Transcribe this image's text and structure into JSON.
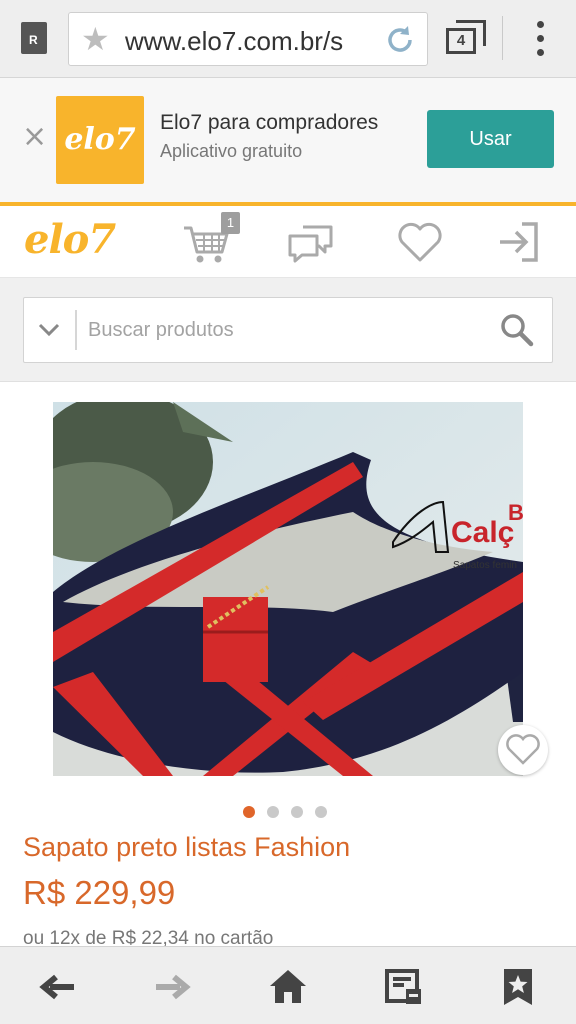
{
  "browser": {
    "url": "www.elo7.com.br/s",
    "tab_count": "4",
    "site_icon_letter": "R"
  },
  "app_banner": {
    "logo_text": "elo7",
    "title": "Elo7 para compradores",
    "subtitle": "Aplicativo gratuito",
    "button_label": "Usar",
    "accent_color": "#2c9f98",
    "logo_color": "#f8b42c"
  },
  "site_nav": {
    "logo": "elo7",
    "cart_count": "1",
    "icons": [
      "cart-icon",
      "chat-icon",
      "heart-icon",
      "login-icon"
    ]
  },
  "search": {
    "placeholder": "Buscar produtos"
  },
  "product": {
    "image_watermark": "Calç",
    "image_watermark_top": "B",
    "image_watermark_sub": "Sapatos femin",
    "title": "Sapato preto listas Fashion",
    "price": "R$ 229,99",
    "installments": "ou 12x de R$ 22,34 no cartão",
    "carousel": {
      "total": 4,
      "active": 1
    },
    "price_color": "#d8682a"
  },
  "bottom_bar": {
    "icons": [
      "back-arrow-icon",
      "forward-arrow-icon",
      "home-icon",
      "reader-icon",
      "bookmark-star-icon"
    ]
  }
}
